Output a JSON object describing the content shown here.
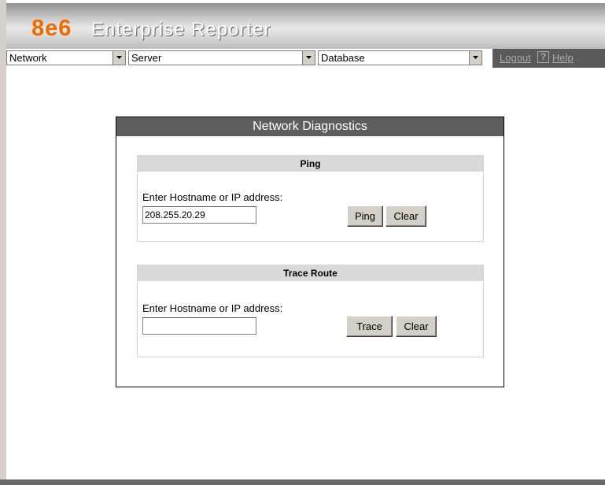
{
  "header": {
    "logo": "8e6",
    "product": "Enterprise Reporter"
  },
  "nav": {
    "network": "Network",
    "server": "Server",
    "database": "Database",
    "logout": "Logout",
    "help_mark": "?",
    "help": "Help"
  },
  "panel": {
    "title": "Network Diagnostics",
    "ping": {
      "heading": "Ping",
      "label": "Enter Hostname or IP address:",
      "value": "208.255.20.29",
      "ping_button": "Ping",
      "clear_button": "Clear"
    },
    "trace": {
      "heading": "Trace Route",
      "label": "Enter Hostname or IP address:",
      "value": "",
      "trace_button": "Trace",
      "clear_button": "Clear"
    }
  },
  "icons": {
    "dropdown": "dropdown-arrow-icon"
  },
  "colors": {
    "logo": "#ee6b00",
    "panel_header": "#5e5e5e",
    "section_header": "#d9d9d9"
  }
}
